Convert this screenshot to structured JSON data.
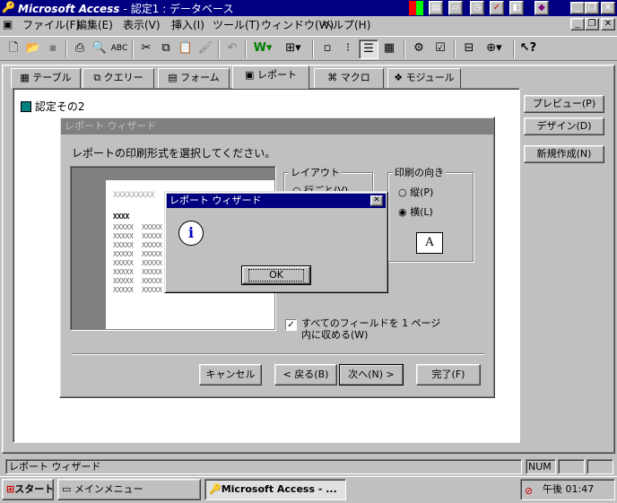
{
  "window": {
    "title_app": "Microsoft Access",
    "title_doc": "- 認定1 : データベース"
  },
  "tray_icons_top": [
    "office-shortcut-icon",
    "notepad-icon",
    "folder-icon",
    "clock-icon",
    "check-icon",
    "paint-icon",
    "book-icon"
  ],
  "menu": [
    "ファイル(F)",
    "編集(E)",
    "表示(V)",
    "挿入(I)",
    "ツール(T)",
    "ウィンドウ(W)",
    "ヘルプ(H)"
  ],
  "toolbar_icons": [
    "new-icon",
    "open-icon",
    "save-icon",
    "print-icon",
    "print-preview-icon",
    "spell-check-icon",
    "cut-icon",
    "copy-icon",
    "paste-icon",
    "format-painter-icon",
    "undo-icon",
    "office-links-icon",
    "analyze-icon",
    "large-icons-icon",
    "small-icons-icon",
    "list-icon",
    "details-icon",
    "code-icon",
    "properties-icon",
    "relationships-icon",
    "new-object-icon",
    "help-icon"
  ],
  "tabs": [
    "テーブル",
    "クエリー",
    "フォーム",
    "レポート",
    "マクロ",
    "モジュール"
  ],
  "active_tab": "レポート",
  "list_items": [
    "認定その2"
  ],
  "side_buttons": [
    "プレビュー(P)",
    "デザイン(D)",
    "新規作成(N)"
  ],
  "wizard": {
    "title": "レポート ウィザード",
    "instruction": "レポートの印刷形式を選択してください。",
    "layout_group": "レイアウト",
    "layout_option_partial": "行ごと(V)",
    "orientation_group": "印刷の向き",
    "orient_portrait": "縦(P)",
    "orient_landscape": "横(L)",
    "orient_selected": "横(L)",
    "fit_checkbox": "すべてのフィールドを 1 ページ内に収める(W)",
    "fit_checked": true,
    "buttons": {
      "cancel": "キャンセル",
      "back": "< 戻る(B)",
      "next": "次へ(N) >",
      "finish": "完了(F)"
    }
  },
  "preview": {
    "header_row": "XXXXXXXXX",
    "bold_row": "XXXX",
    "cell": "XXXXX"
  },
  "msgbox": {
    "title": "レポート ウィザード",
    "ok": "OK",
    "icon": "information-icon"
  },
  "status": {
    "text": "レポート ウィザード",
    "num": "NUM"
  },
  "taskbar": {
    "start": "スタート",
    "tasks": [
      "メインメニュー",
      "Microsoft Access - ..."
    ],
    "clock": "午後 01:47"
  }
}
